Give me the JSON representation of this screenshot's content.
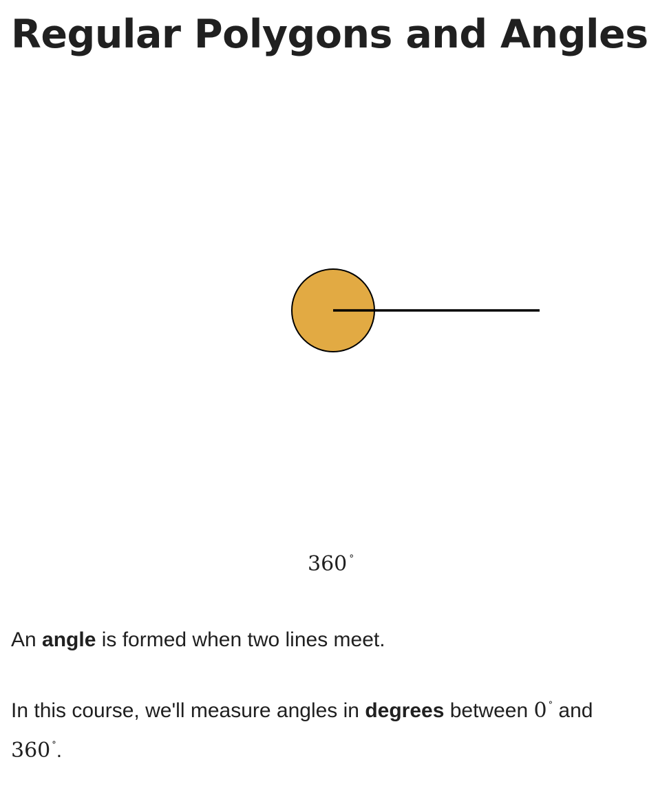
{
  "page": {
    "title": "Regular Polygons and Angles"
  },
  "figure": {
    "angle_value": "360",
    "degree_symbol": "°",
    "fill_color": "#E2AA43",
    "stroke_color": "#000000"
  },
  "content": {
    "paragraph_1": {
      "prefix": "An ",
      "bold": "angle",
      "suffix": " is formed when two lines meet."
    },
    "paragraph_2": {
      "prefix": "In this course, we'll measure angles in ",
      "bold": "degrees",
      "middle": " between ",
      "min_value": "0",
      "connector": " and",
      "max_value": "360",
      "end": "."
    }
  }
}
